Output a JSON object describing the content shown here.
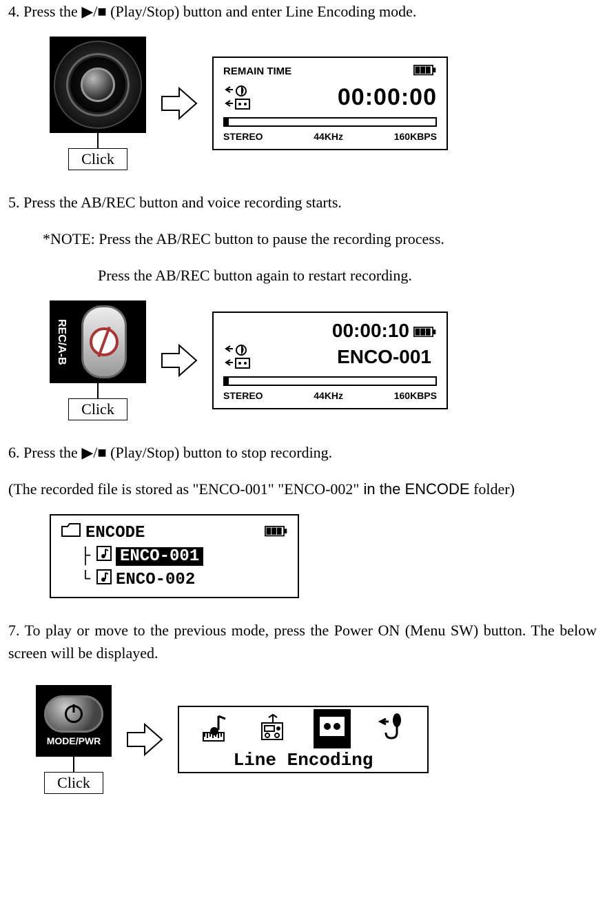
{
  "step4": {
    "text": "4. Press the ▶/■ (Play/Stop) button and enter Line Encoding mode.",
    "click": "Click"
  },
  "lcd1": {
    "remain": "REMAIN TIME",
    "time": "00:00:00",
    "stereo": "STEREO",
    "khz": "44KHz",
    "kbps": "160KBPS"
  },
  "step5": {
    "text": "5. Press the AB/REC button and voice recording starts.",
    "note": "*NOTE: Press the AB/REC button to pause the recording process.",
    "note2": "Press the AB/REC button again to restart recording.",
    "click": "Click",
    "recside": "REC/A-B"
  },
  "lcd2": {
    "time": "00:00:10",
    "file": "ENCO-001",
    "stereo": "STEREO",
    "khz": "44KHz",
    "kbps": "160KBPS"
  },
  "step6": {
    "line1": "6.  Press the ▶/■ (Play/Stop) button to stop recording.",
    "line2a": "(The recorded file is stored as \"ENCO-001\" \"ENCO-002\"",
    "line2b": " in the ENCODE",
    "line2c": " folder)"
  },
  "encscreen": {
    "folder": "ENCODE",
    "f1": "ENCO-001",
    "f2": "ENCO-002"
  },
  "step7": {
    "text": "7. To play or move to the previous mode, press the Power ON (Menu SW) button. The below screen will be displayed.",
    "click": "Click",
    "modepwr": "MODE/PWR"
  },
  "modestrip": {
    "title": "Line Encoding"
  }
}
